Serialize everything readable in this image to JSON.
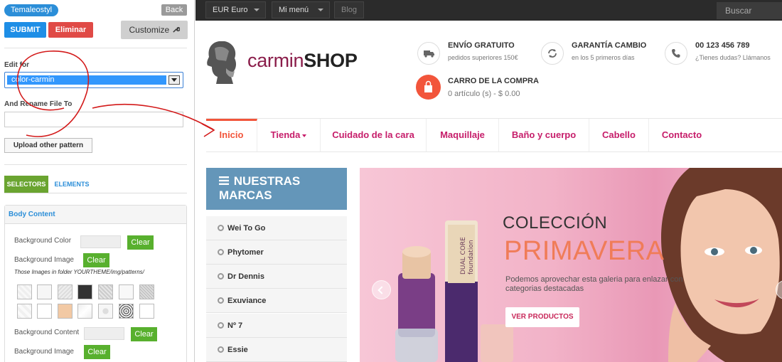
{
  "panel": {
    "theme_pill": "Temaleostyl",
    "back_label": "Back",
    "submit_label": "SUBMIT",
    "delete_label": "Eliminar",
    "customize_label": "Customize",
    "edit_for_label": "Edit for",
    "edit_for_value": "color-carmin",
    "rename_label": "And Rename File To",
    "rename_value": "",
    "upload_label": "Upload other pattern",
    "tabs": {
      "selectors": "SELECTORS",
      "elements": "ELEMENTS"
    },
    "section_title": "Body Content",
    "bg_color_label": "Background Color",
    "bg_image_label": "Background Image",
    "patterns_note": "Those Images in folder YOURTHEME/img/patterns/",
    "bg_content_label": "Background Content",
    "bg_image2_label": "Background Image",
    "clear_label": "Clear"
  },
  "topbar": {
    "currency": "EUR Euro",
    "menu": "Mi menú",
    "blog": "Blog",
    "search_placeholder": "Buscar"
  },
  "header": {
    "logo_left": "carmin",
    "logo_right": "SHOP",
    "shipping_title": "ENVÍO GRATUITO",
    "shipping_sub": "pedidos superiores 150€",
    "exchange_title": "GARANTÍA CAMBIO",
    "exchange_sub": "en los 5 primeros días",
    "phone_title": "00 123 456 789",
    "phone_sub": "¿Tienes dudas? Llámanos",
    "cart_title": "CARRO DE LA COMPRA",
    "cart_sub": "0 artículo (s) - $ 0.00"
  },
  "nav": [
    "Inicio",
    "Tienda",
    "Cuidado de la cara",
    "Maquillaje",
    "Baño y cuerpo",
    "Cabello",
    "Contacto"
  ],
  "brands": {
    "title_line1": "NUESTRAS",
    "title_line2": "MARCAS",
    "items": [
      "Wei To Go",
      "Phytomer",
      "Dr Dennis",
      "Exuviance",
      "Nº 7",
      "Essie"
    ]
  },
  "banner": {
    "title1": "COLECCIÓN",
    "title2": "PRIMAVERA",
    "desc": "Podemos aprovechar esta galeria para enlazar con categorias destacadas",
    "button": "VER PRODUCTOS",
    "product_lines": [
      "DUAL CORE",
      "foundation"
    ]
  },
  "colors": {
    "accent": "#c61d6a",
    "orange": "#f2553b",
    "blue": "#2b8ed8",
    "green": "#58b02e",
    "brands_head": "#6496b9"
  }
}
